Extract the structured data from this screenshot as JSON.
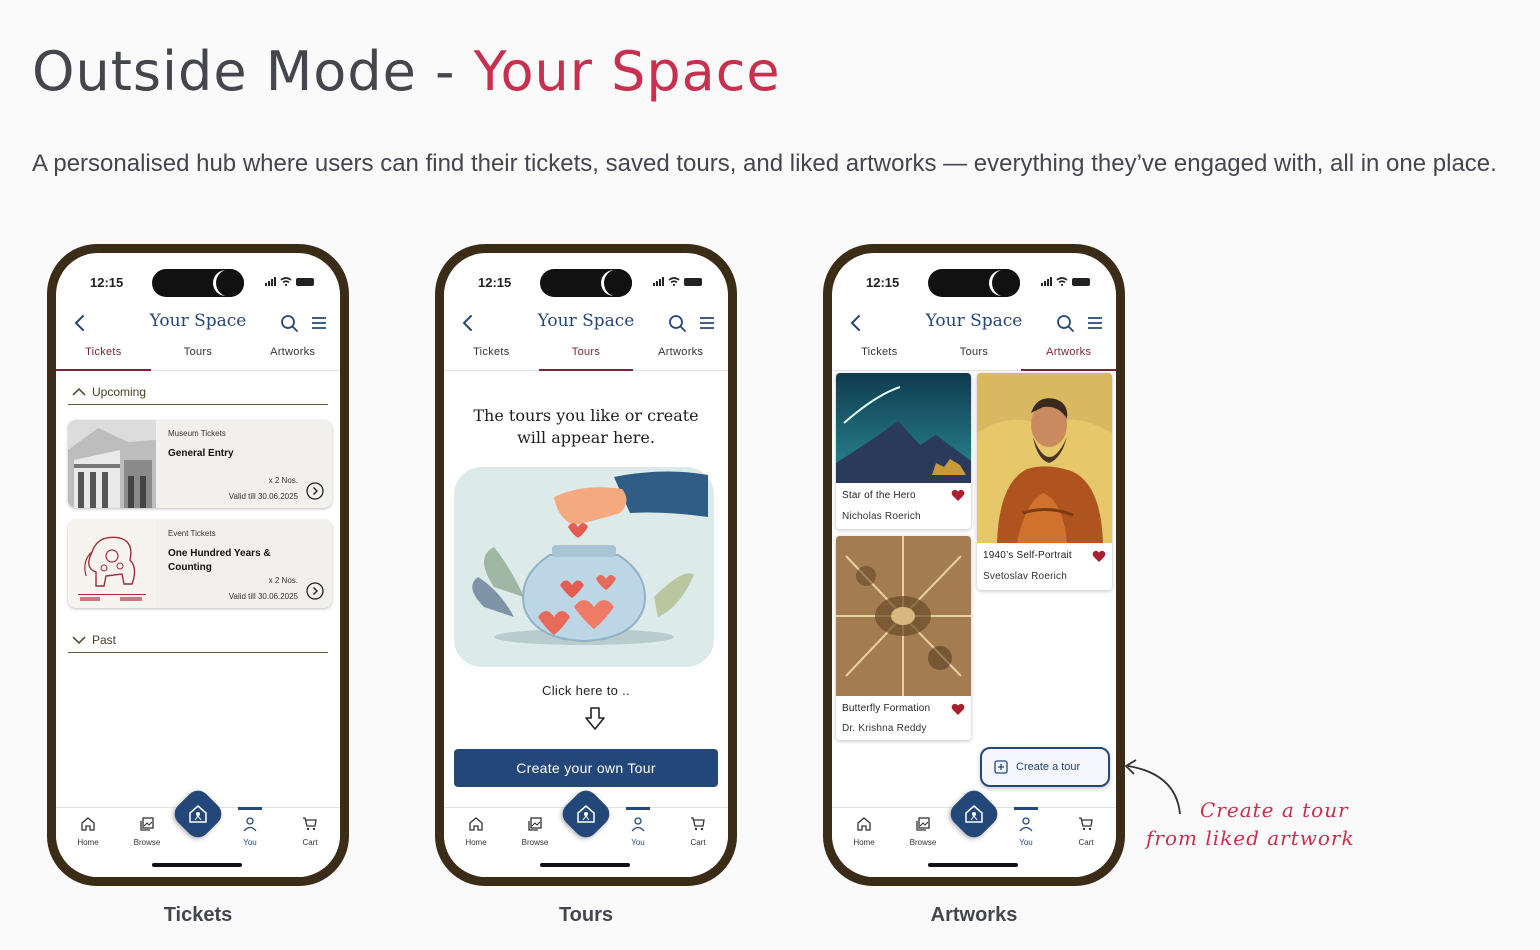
{
  "heading": {
    "plain": "Outside Mode - ",
    "accent": "Your Space"
  },
  "description": "A personalised hub where users can find their tickets, saved tours, and liked artworks — everything they’ve engaged with, all in one place.",
  "colors": {
    "accent": "#c9304f",
    "primary": "#24477a",
    "frame": "#3b2c17",
    "tab_active": "#7a2436"
  },
  "status_time": "12:15",
  "app_title": "Your Space",
  "tabs": [
    "Tickets",
    "Tours",
    "Artworks"
  ],
  "nav": [
    "Home",
    "Browse",
    "You",
    "Cart"
  ],
  "tickets_screen": {
    "caption": "Tickets",
    "upcoming_label": "Upcoming",
    "past_label": "Past",
    "tickets": [
      {
        "type": "Museum Tickets",
        "name": "General Entry",
        "qty": "x 2 Nos.",
        "valid": "Valid till 30.06.2025"
      },
      {
        "type": "Event Tickets",
        "name": "One Hundred Years & Counting",
        "qty": "x 2 Nos.",
        "valid": "Valid till 30.06.2025"
      }
    ]
  },
  "tours_screen": {
    "caption": "Tours",
    "empty_title": "The tours you like or create will appear here.",
    "click_text": "Click here to ..",
    "cta": "Create your own Tour"
  },
  "artworks_screen": {
    "caption": "Artworks",
    "artworks": [
      {
        "title": "Star of the Hero",
        "artist": "Nicholas Roerich"
      },
      {
        "title": "1940’s Self-Portrait",
        "artist": "Svetoslav Roerich"
      },
      {
        "title": "Butterfly Formation",
        "artist": "Dr. Krishna Reddy"
      }
    ],
    "fab": "Create a tour"
  },
  "annotation": {
    "line1": "Create a tour",
    "line2": "from liked artwork"
  }
}
